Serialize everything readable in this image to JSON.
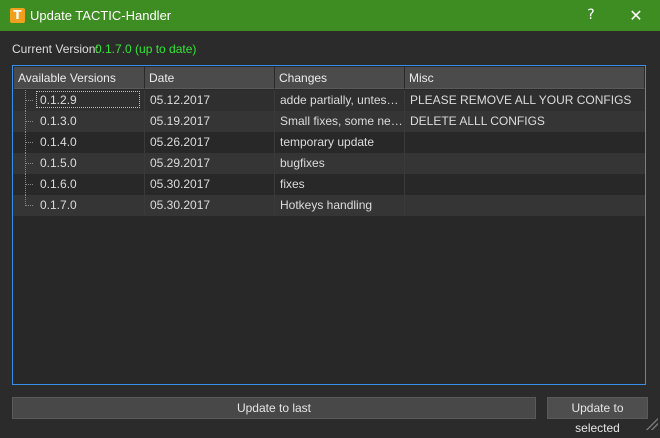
{
  "window": {
    "title": "Update TACTIC-Handler",
    "help": "?",
    "close": "✕",
    "icon_letter": "T"
  },
  "current_version": {
    "label": "Current Version:",
    "value": "0.1.7.0 (up to date)"
  },
  "table": {
    "columns": [
      "Available Versions",
      "Date",
      "Changes",
      "Misc"
    ],
    "rows": [
      {
        "version": "0.1.2.9",
        "date": "05.12.2017",
        "changes": "adde partially, untes…",
        "misc": "PLEASE REMOVE ALL YOUR CONFIGS"
      },
      {
        "version": "0.1.3.0",
        "date": "05.19.2017",
        "changes": "Small fixes, some ne…",
        "misc": "DELETE ALLL CONFIGS"
      },
      {
        "version": "0.1.4.0",
        "date": "05.26.2017",
        "changes": "temporary update",
        "misc": ""
      },
      {
        "version": "0.1.5.0",
        "date": "05.29.2017",
        "changes": "bugfixes",
        "misc": ""
      },
      {
        "version": "0.1.6.0",
        "date": "05.30.2017",
        "changes": "fixes",
        "misc": ""
      },
      {
        "version": "0.1.7.0",
        "date": "05.30.2017",
        "changes": "Hotkeys handling",
        "misc": ""
      }
    ]
  },
  "buttons": {
    "update_last": "Update to last",
    "update_selected": "Update to selected"
  }
}
